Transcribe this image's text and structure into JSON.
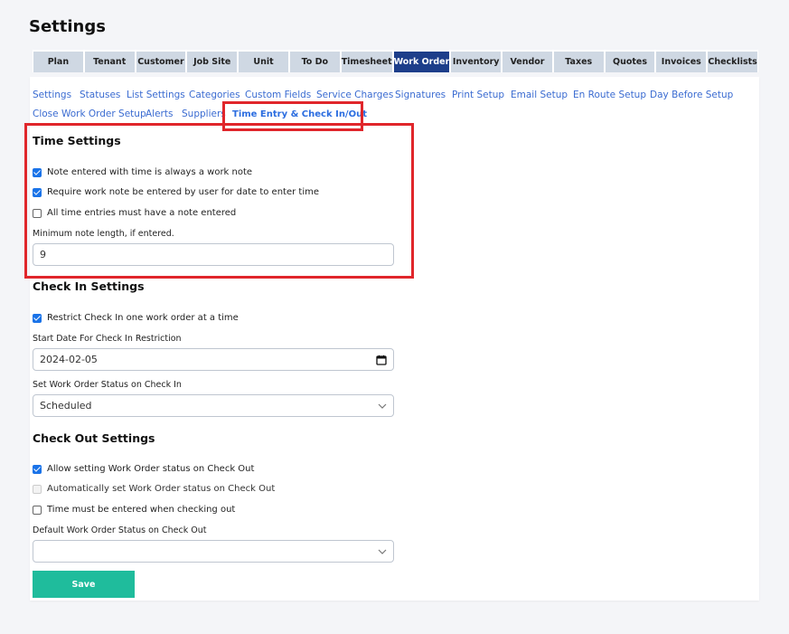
{
  "page": {
    "title": "Settings"
  },
  "top_tabs": [
    {
      "label": "Plan",
      "active": false
    },
    {
      "label": "Tenant",
      "active": false
    },
    {
      "label": "Customer",
      "active": false
    },
    {
      "label": "Job Site",
      "active": false
    },
    {
      "label": "Unit",
      "active": false
    },
    {
      "label": "To Do",
      "active": false
    },
    {
      "label": "Timesheet",
      "active": false
    },
    {
      "label": "Work Order",
      "active": true
    },
    {
      "label": "Inventory",
      "active": false
    },
    {
      "label": "Vendor",
      "active": false
    },
    {
      "label": "Taxes",
      "active": false
    },
    {
      "label": "Quotes",
      "active": false
    },
    {
      "label": "Invoices",
      "active": false
    },
    {
      "label": "Checklists",
      "active": false
    }
  ],
  "sub_nav": [
    {
      "label": "Settings"
    },
    {
      "label": "Statuses"
    },
    {
      "label": "List Settings"
    },
    {
      "label": "Categories"
    },
    {
      "label": "Custom Fields"
    },
    {
      "label": "Service Charges"
    },
    {
      "label": "Signatures"
    },
    {
      "label": "Print Setup"
    },
    {
      "label": "Email Setup"
    },
    {
      "label": "En Route Setup"
    },
    {
      "label": "Day Before Setup"
    },
    {
      "label": "Close Work Order Setup"
    },
    {
      "label": "Alerts"
    },
    {
      "label": "Suppliers"
    },
    {
      "label": "Time Entry & Check In/Out",
      "active": true
    }
  ],
  "time_settings": {
    "heading": "Time Settings",
    "checkboxes": [
      {
        "label": "Note entered with time is always a work note",
        "checked": true
      },
      {
        "label": "Require work note be entered by user for date to enter time",
        "checked": true
      },
      {
        "label": "All time entries must have a note entered",
        "checked": false
      }
    ],
    "min_note_label": "Minimum note length, if entered.",
    "min_note_value": "9"
  },
  "check_in": {
    "heading": "Check In Settings",
    "restrict_label": "Restrict Check In one work order at a time",
    "restrict_checked": true,
    "start_date_label": "Start Date For Check In Restriction",
    "start_date_value": "2024-02-05",
    "status_label": "Set Work Order Status on Check In",
    "status_value": "Scheduled"
  },
  "check_out": {
    "heading": "Check Out Settings",
    "checkboxes": [
      {
        "label": "Allow setting Work Order status on Check Out",
        "checked": true,
        "disabled": false
      },
      {
        "label": "Automatically set Work Order status on Check Out",
        "checked": false,
        "disabled": true
      },
      {
        "label": "Time must be entered when checking out",
        "checked": false,
        "disabled": false
      }
    ],
    "default_status_label": "Default Work Order Status on Check Out",
    "default_status_value": ""
  },
  "actions": {
    "save_label": "Save"
  },
  "colors": {
    "accent": "#1d3e8a",
    "save": "#1fbc9c",
    "highlight": "#e0262b",
    "link": "#3a6bd1"
  },
  "icons": {
    "calendar": "calendar-icon",
    "dropdown": "chevron-down-icon"
  }
}
